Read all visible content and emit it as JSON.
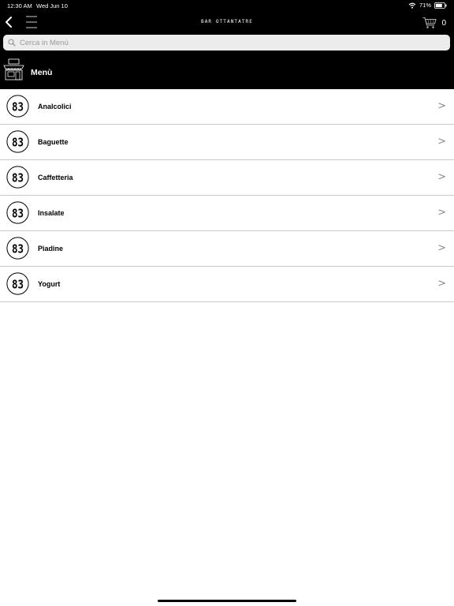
{
  "status_bar": {
    "time": "12:30 AM",
    "date": "Wed Jun 10",
    "battery": "71%"
  },
  "navbar": {
    "brand": "BAR OTTANTATRE",
    "cart_count": "0"
  },
  "search": {
    "placeholder": "Cerca in Menù"
  },
  "section": {
    "title": "Menù"
  },
  "logo_text": "83",
  "categories": [
    {
      "label": "Analcolici",
      "chevron": ">"
    },
    {
      "label": "Baguette",
      "chevron": ">"
    },
    {
      "label": "Caffetteria",
      "chevron": ">"
    },
    {
      "label": "Insalate",
      "chevron": ">"
    },
    {
      "label": "Piadine",
      "chevron": ">"
    },
    {
      "label": "Yogurt",
      "chevron": ">"
    }
  ]
}
